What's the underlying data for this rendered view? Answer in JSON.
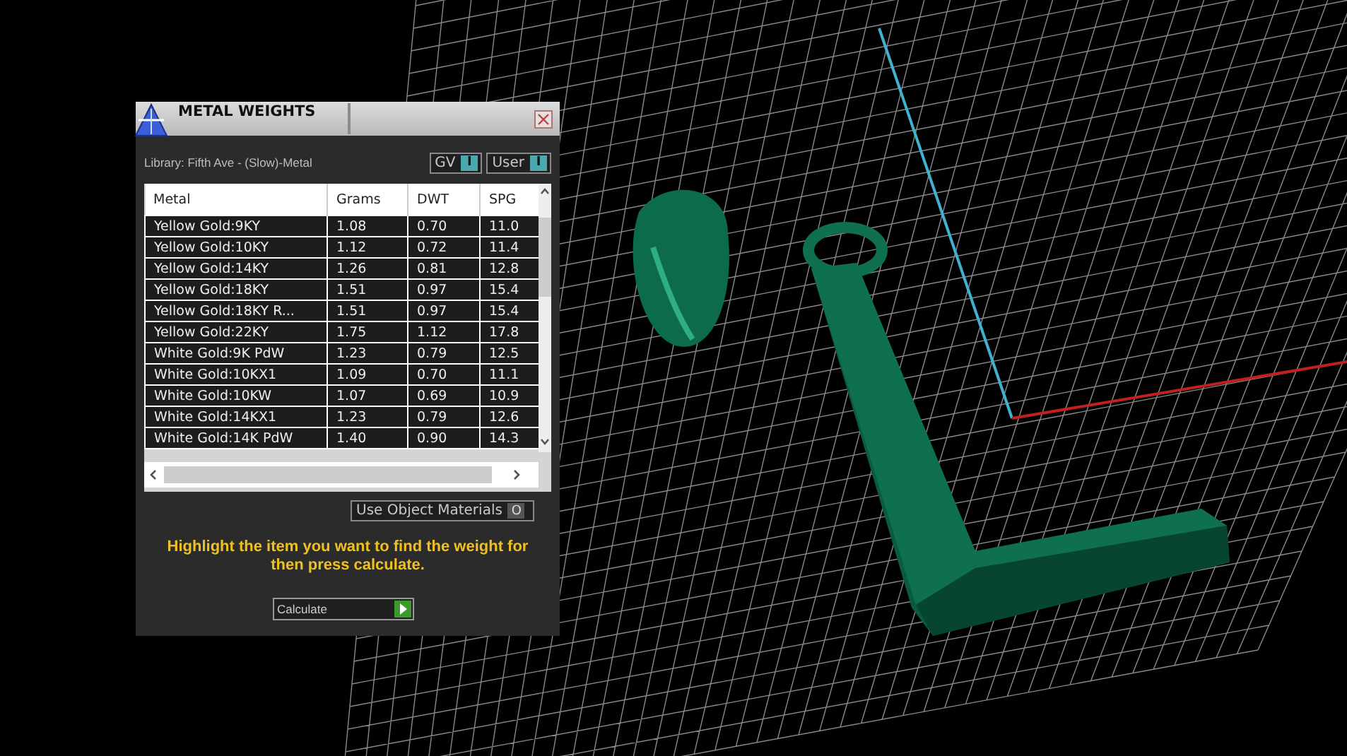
{
  "window": {
    "title": "METAL WEIGHTS"
  },
  "library": {
    "label": "Library: Fifth Ave - (Slow)-Metal"
  },
  "toggles": [
    {
      "label": "GV",
      "glyph": "I",
      "on": true
    },
    {
      "label": "User",
      "glyph": "I",
      "on": true
    }
  ],
  "table": {
    "columns": [
      "Metal",
      "Grams",
      "DWT",
      "SPG"
    ],
    "rows": [
      {
        "cells": [
          "Yellow Gold:9KY",
          "1.08",
          "0.70",
          "11.0"
        ]
      },
      {
        "cells": [
          "Yellow Gold:10KY",
          "1.12",
          "0.72",
          "11.4"
        ]
      },
      {
        "cells": [
          "Yellow Gold:14KY",
          "1.26",
          "0.81",
          "12.8"
        ]
      },
      {
        "cells": [
          "Yellow Gold:18KY",
          "1.51",
          "0.97",
          "15.4"
        ]
      },
      {
        "cells": [
          "Yellow Gold:18KY R...",
          "1.51",
          "0.97",
          "15.4"
        ]
      },
      {
        "cells": [
          "Yellow Gold:22KY",
          "1.75",
          "1.12",
          "17.8"
        ]
      },
      {
        "cells": [
          "White Gold:9K PdW",
          "1.23",
          "0.79",
          "12.5"
        ]
      },
      {
        "cells": [
          "White Gold:10KX1",
          "1.09",
          "0.70",
          "11.1"
        ]
      },
      {
        "cells": [
          "White Gold:10KW",
          "1.07",
          "0.69",
          "10.9"
        ]
      },
      {
        "cells": [
          "White Gold:14KX1",
          "1.23",
          "0.79",
          "12.6"
        ]
      },
      {
        "cells": [
          "White Gold:14K PdW",
          "1.40",
          "0.90",
          "14.3"
        ]
      }
    ]
  },
  "use_object_materials": {
    "label": "Use Object Materials",
    "glyph": "O",
    "on": false
  },
  "hint": "Highlight the item you want to find the weight for then press calculate.",
  "calculate_button": {
    "label": "Calculate"
  }
}
